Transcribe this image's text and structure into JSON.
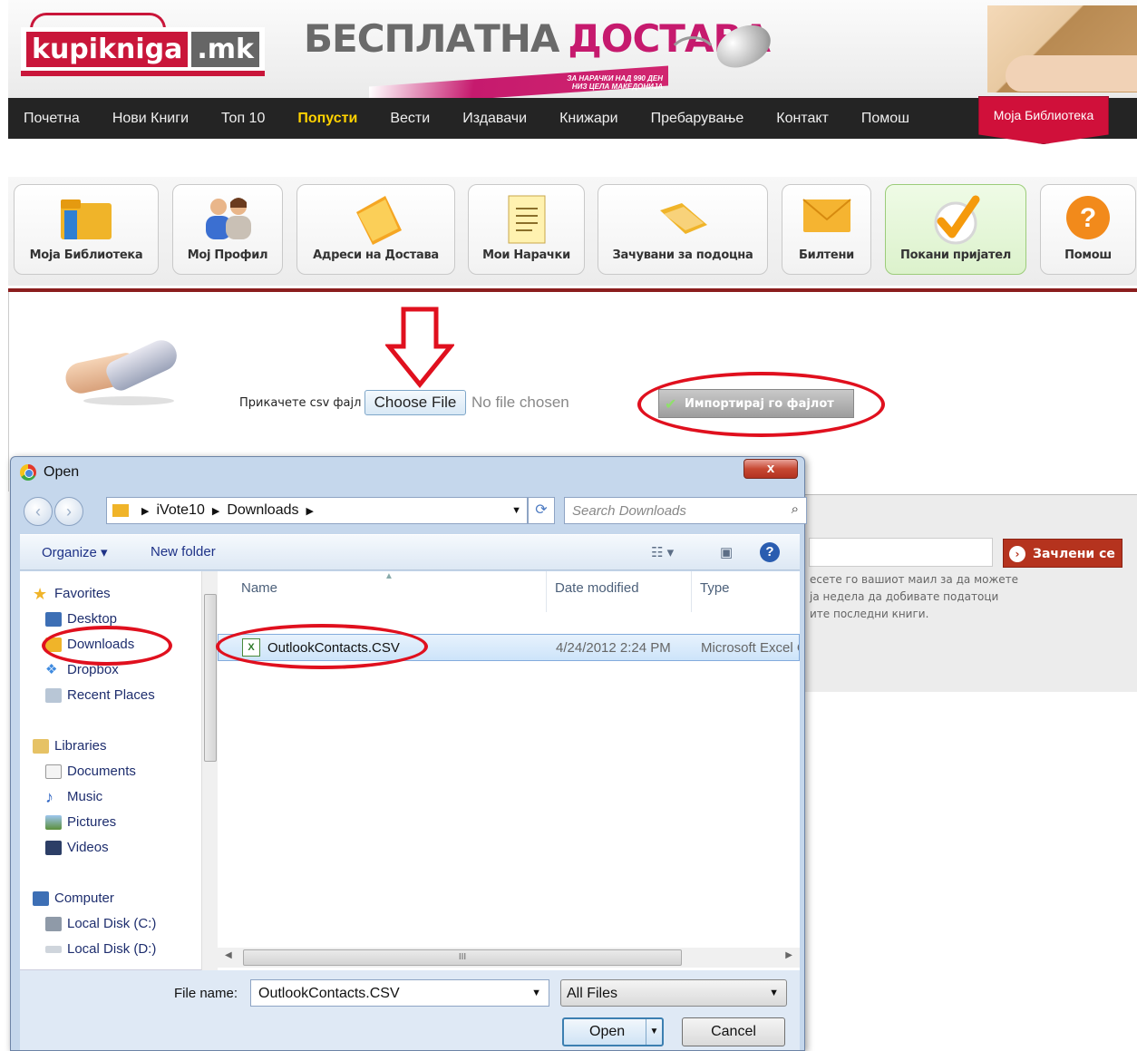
{
  "header": {
    "logo_main": "kupikniga",
    "logo_tld": ".mk",
    "promo_part1": "БЕСПЛАТНА",
    "promo_part2": "ДОСТАВА",
    "promo_sub_line1": "ЗА НАРАЧКИ НАД 990 ДЕН",
    "promo_sub_line2": "НИЗ ЦЕЛА МАКЕДОНИЈА"
  },
  "nav": {
    "items": [
      "Почетна",
      "Нови Книги",
      "Топ 10",
      "Попусти",
      "Вести",
      "Издавачи",
      "Книжари",
      "Пребарување",
      "Контакт",
      "Помош"
    ],
    "active_index": 3,
    "library_tab": "Моја Библиотека"
  },
  "toolbar": {
    "items": [
      "Моја Библиотека",
      "Мој Профил",
      "Адреси на Достава",
      "Мои Нарачки",
      "Зачувани за подоцна",
      "Билтени",
      "Покани пријател",
      "Помош"
    ],
    "highlighted_index": 6
  },
  "upload": {
    "attach_label": "Прикачете csv фајл",
    "choose_label": "Choose File",
    "no_file_text": "No file chosen",
    "import_label": "Импортирај го фајлот"
  },
  "subscribe": {
    "button_label": "Зачлени се",
    "text_line1": "есете го вашиот маил за да можете",
    "text_line2": "ја недела да добивате податоци",
    "text_line3": "ите последни книги."
  },
  "dialog": {
    "title": "Open",
    "close_label": "x",
    "breadcrumb": [
      "iVote10",
      "Downloads"
    ],
    "search_placeholder": "Search Downloads",
    "organize_label": "Organize ▾",
    "new_folder_label": "New folder",
    "nav_tree": {
      "favorites_header": "Favorites",
      "favorites": [
        "Desktop",
        "Downloads",
        "Dropbox",
        "Recent Places"
      ],
      "libraries_header": "Libraries",
      "libraries": [
        "Documents",
        "Music",
        "Pictures",
        "Videos"
      ],
      "computer_header": "Computer",
      "drives": [
        "Local Disk (C:)",
        "Local Disk (D:)"
      ]
    },
    "columns": [
      "Name",
      "Date modified",
      "Type"
    ],
    "files": [
      {
        "name": "OutlookContacts.CSV",
        "modified": "4/24/2012 2:24 PM",
        "type": "Microsoft Excel C"
      }
    ],
    "filename_label": "File name:",
    "filename_value": "OutlookContacts.CSV",
    "filetype_value": "All Files",
    "open_label": "Open",
    "cancel_label": "Cancel",
    "scroll_mark": "III"
  },
  "colors": {
    "brand_red": "#c9163a",
    "nav_bg": "#242424",
    "nav_active": "#ffd200",
    "annotation_red": "#e0101e"
  }
}
